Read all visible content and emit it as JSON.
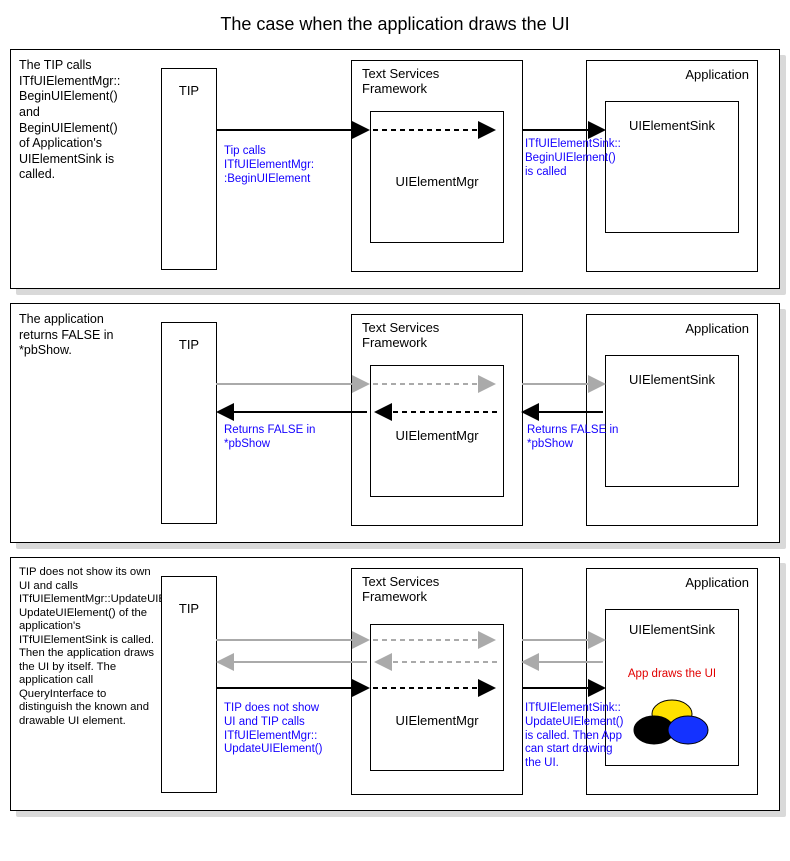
{
  "title": "The case when the application draws the UI",
  "common": {
    "tip": "TIP",
    "tsf": "Text Services\nFramework",
    "app": "Application",
    "uemgr": "UIElementMgr",
    "uesink": "UIElementSink"
  },
  "panel1": {
    "desc": "The TIP calls\nITfUIElementMgr::\nBeginUIElement()\nand\nBeginUIElement()\nof Application's\nUIElementSink is\ncalled.",
    "cap_left": "Tip calls\nITfUIElementMgr:\n:BeginUIElement",
    "cap_right": "ITfUIElementSink::\nBeginUIElement()\nis called"
  },
  "panel2": {
    "desc": "The application\nreturns FALSE in\n*pbShow.",
    "cap_left": "Returns FALSE in\n*pbShow",
    "cap_right": "Returns FALSE in\n*pbShow"
  },
  "panel3": {
    "desc": "TIP does not show its own UI and calls ITfUIElementMgr::UpdateUIElement(). UpdateUIElement() of the application's ITfUIElementSink is called. Then the application draws the UI by itself. The application call QueryInterface to distinguish the known and drawable UI element.",
    "cap_left": "TIP does not show\nUI and TIP calls\nITfUIElementMgr::\nUpdateUIElement()",
    "cap_right": "ITfUIElementSink::\nUpdateUIElement()\nis called. Then App\ncan start drawing\nthe UI.",
    "red": "App draws the UI"
  }
}
